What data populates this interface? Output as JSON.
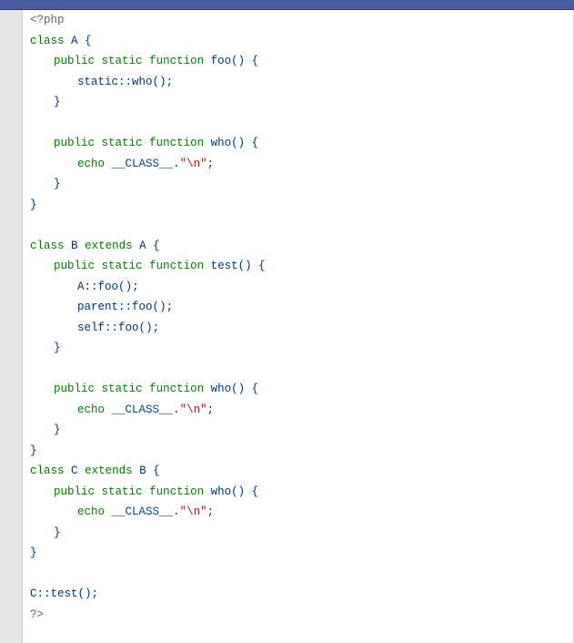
{
  "code": {
    "php_open": "<?php",
    "class_kw": "class",
    "extends_kw": "extends",
    "public_kw": "public",
    "static_kw": "static",
    "function_kw": "function",
    "echo_kw": "echo",
    "classA": "A",
    "classB": "B",
    "classC": "C",
    "fn_foo": "foo",
    "fn_who": "who",
    "fn_test": "test",
    "static_call": "static",
    "parent_call": "parent",
    "self_call": "self",
    "dbl_colon": "::",
    "magic_class": "__CLASS__",
    "concat": ".",
    "newline_str": "\"\\n\"",
    "semi": ";",
    "lbrace": "{",
    "rbrace": "}",
    "lparen": "(",
    "rparen": ")",
    "space": " ",
    "call_c_test": "C::test();",
    "php_close": "?>"
  }
}
